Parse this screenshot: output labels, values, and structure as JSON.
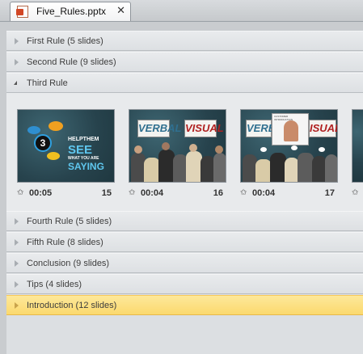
{
  "tab": {
    "title": "Five_Rules.pptx",
    "close": "✕",
    "icon": "powerpoint-file-icon"
  },
  "sections": [
    {
      "label": "First Rule (5 slides)",
      "expanded": false
    },
    {
      "label": "Second Rule (9 slides)",
      "expanded": false
    },
    {
      "label": "Third Rule",
      "expanded": true
    },
    {
      "label": "Fourth Rule (5 slides)",
      "expanded": false
    },
    {
      "label": "Fifth Rule (8 slides)",
      "expanded": false
    },
    {
      "label": "Conclusion (9 slides)",
      "expanded": false
    },
    {
      "label": "Tips (4 slides)",
      "expanded": false
    },
    {
      "label": "Introduction (12 slides)",
      "expanded": false,
      "highlighted": true
    }
  ],
  "slides": [
    {
      "time": "00:05",
      "number": "15",
      "text": {
        "badge": "3",
        "line1": "HELPTHEM",
        "line2": "SEE",
        "line3": "WHAT YOU ARE",
        "line4": "SAYING"
      }
    },
    {
      "time": "00:04",
      "number": "16",
      "text": {
        "sign_left": "VERBAL",
        "sign_right": "VISUAL"
      }
    },
    {
      "time": "00:04",
      "number": "17",
      "text": {
        "sign_left": "VERB",
        "sign_right": "ISUAL",
        "card": "CUSTOMER INTRODUCTION"
      }
    }
  ],
  "colors": {
    "highlight": "#fbd96e",
    "slide_bg": "#2f4f5a"
  }
}
